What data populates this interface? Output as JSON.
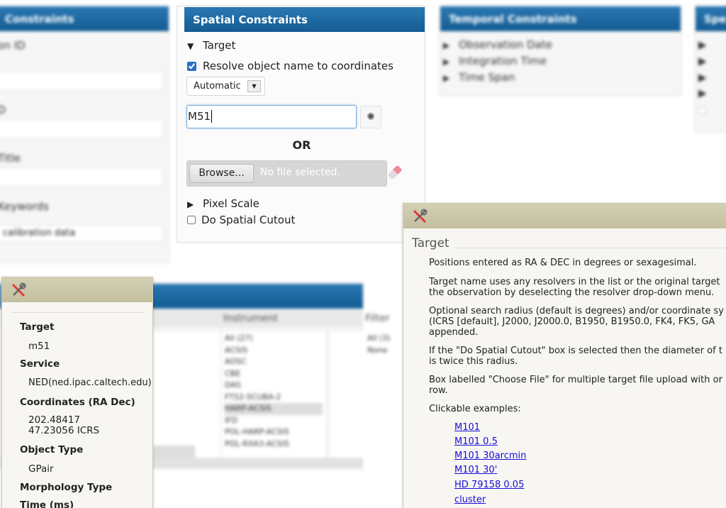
{
  "left_panel": {
    "title": "Constraints",
    "fields": [
      "ion ID",
      "ID",
      "Title",
      "Keywords"
    ],
    "select_value": "calibration data"
  },
  "spatial": {
    "title": "Spatial Constraints",
    "target_label": "Target",
    "resolve_label": "Resolve object name to coordinates",
    "resolve_checked": true,
    "resolver_select": "Automatic",
    "target_value": "M51",
    "or_label": "OR",
    "browse_label": "Browse...",
    "no_file": "No file selected.",
    "pixel_scale_label": "Pixel Scale",
    "cutout_label": "Do Spatial Cutout",
    "cutout_checked": false
  },
  "temporal": {
    "title": "Temporal Constraints",
    "items": [
      "Observation Date",
      "Integration Time",
      "Time Span"
    ]
  },
  "right_panel": {
    "title": "Spe"
  },
  "bottom_panel": {
    "col_instrument": "Instrument",
    "col_filter": "Filter",
    "instruments": [
      "All (27)",
      "ACSIS",
      "AOSC",
      "CBE",
      "DAS",
      "FTS2-SCUBA-2",
      "HARP-ACSIS",
      "IFD",
      "POL-HARP-ACSIS",
      "POL-RXA3-ACSIS"
    ],
    "filters": [
      "All (3)",
      "None"
    ]
  },
  "resolver_dialog": {
    "target_label": "Target",
    "target_value": "m51",
    "service_label": "Service",
    "service_value": "NED(ned.ipac.caltech.edu)",
    "coords_label": "Coordinates (RA Dec)",
    "ra": "202.48417",
    "dec": "47.23056 ICRS",
    "objtype_label": "Object Type",
    "objtype_value": "GPair",
    "morph_label": "Morphology Type",
    "time_label": "Time (ms)"
  },
  "help_dialog": {
    "title": "Target",
    "p1": "Positions entered as RA & DEC in degrees or sexagesimal.",
    "p2a": "Target name uses any resolvers in the list or the original target",
    "p2b": "the observation by deselecting the resolver drop-down menu.",
    "p3a": "Optional search radius (default is degrees) and/or coordinate sy",
    "p3b": "(ICRS [default], J2000, J2000.0, B1950, B1950.0, FK4, FK5, GA",
    "p3c": "appended.",
    "p4a": "If the \"Do Spatial Cutout\" box is selected then the diameter of t",
    "p4b": "is twice this radius.",
    "p5a": "Box labelled \"Choose File\" for multiple target file upload with or",
    "p5b": "row.",
    "p6": "Clickable examples:",
    "examples": [
      "M101",
      "M101 0.5",
      "M101 30arcmin",
      "M101 30'",
      "HD 79158 0.05",
      "cluster"
    ]
  },
  "colors": {
    "header_blue": "#1d67a1",
    "dialog_header": "#c9c5a7",
    "link": "#1a0dd8"
  }
}
